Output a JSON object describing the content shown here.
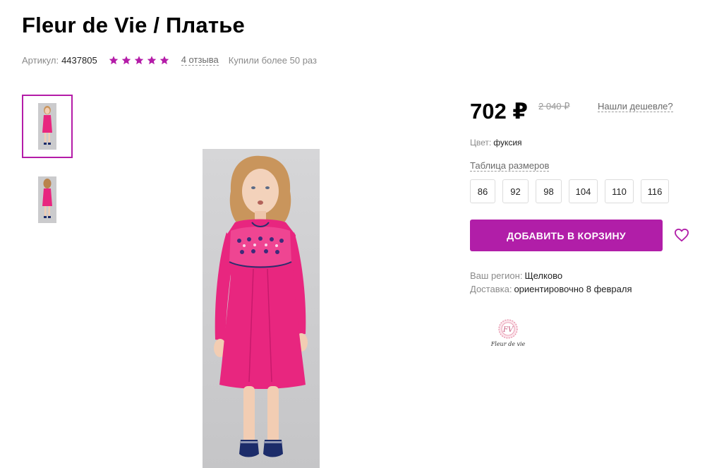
{
  "product": {
    "title": "Fleur de Vie / Платье",
    "article_label": "Артикул:",
    "article_value": "4437805",
    "rating_stars": 5,
    "reviews_link": "4 отзыва",
    "purchases_text": "Купили более 50 раз"
  },
  "price": {
    "current": "702 ₽",
    "old": "2 040 ₽",
    "cheaper_link": "Нашли дешевле?"
  },
  "color": {
    "label": "Цвет:",
    "value": "фуксия"
  },
  "sizes": {
    "table_link": "Таблица размеров",
    "options": [
      "86",
      "92",
      "98",
      "104",
      "110",
      "116"
    ]
  },
  "actions": {
    "add_to_cart": "ДОБАВИТЬ В КОРЗИНУ"
  },
  "delivery": {
    "region_label": "Ваш регион:",
    "region_value": "Щелково",
    "delivery_label": "Доставка:",
    "delivery_value": "ориентировочно 8 февраля"
  },
  "brand": {
    "logo_text": "Fleur de vie",
    "monogram": "FV"
  },
  "colors": {
    "accent": "#b11ea8",
    "star": "#b41ca8",
    "dress": "#e8267f"
  },
  "icons": {
    "star": "star-icon",
    "heart": "heart-outline-icon"
  }
}
